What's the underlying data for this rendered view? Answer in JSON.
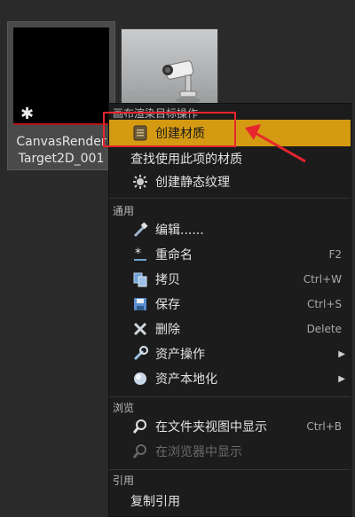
{
  "assets": [
    {
      "label_line1": "CanvasRender",
      "label_line2": "Target2D_001"
    },
    {
      "label_line1": "",
      "label_line2": ""
    }
  ],
  "menu": {
    "sections": [
      {
        "header": "画布渲染目标操作",
        "items": [
          {
            "label": "创建材质",
            "icon": "material-icon",
            "highlighted": true
          },
          {
            "label": "查找使用此项的材质",
            "icon": ""
          },
          {
            "label": "创建静态纹理",
            "icon": "texture-icon"
          }
        ]
      },
      {
        "header": "通用",
        "items": [
          {
            "label": "编辑......",
            "icon": "edit-icon"
          },
          {
            "label": "重命名",
            "icon": "rename-icon",
            "shortcut": "F2"
          },
          {
            "label": "拷贝",
            "icon": "copy-icon",
            "shortcut": "Ctrl+W"
          },
          {
            "label": "保存",
            "icon": "save-icon",
            "shortcut": "Ctrl+S"
          },
          {
            "label": "删除",
            "icon": "delete-icon",
            "shortcut": "Delete"
          },
          {
            "label": "资产操作",
            "icon": "wrench-icon",
            "submenu": true
          },
          {
            "label": "资产本地化",
            "icon": "globe-icon",
            "submenu": true
          }
        ]
      },
      {
        "header": "浏览",
        "items": [
          {
            "label": "在文件夹视图中显示",
            "icon": "search-icon",
            "shortcut": "Ctrl+B"
          },
          {
            "label": "在浏览器中显示",
            "icon": "search-icon",
            "disabled": true
          }
        ]
      },
      {
        "header": "引用",
        "items": [
          {
            "label": "复制引用",
            "icon": ""
          }
        ]
      }
    ]
  },
  "colors": {
    "highlight": "#d49a12",
    "annotation_red": "#e8252c",
    "menu_bg": "#1c1c1c"
  }
}
